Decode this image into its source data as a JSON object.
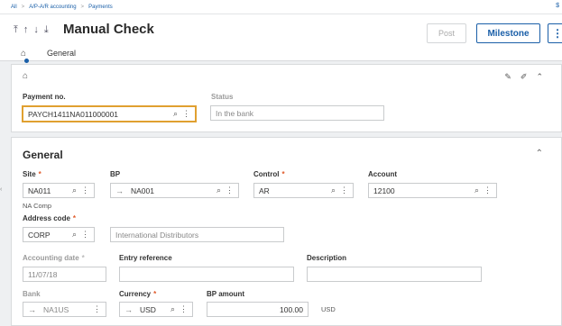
{
  "breadcrumb": {
    "items": [
      "All",
      "A/P-A/R accounting",
      "Payments"
    ]
  },
  "page": {
    "title": "Manual Check"
  },
  "nav": {
    "arrows": [
      "⤒",
      "↑",
      "↓",
      "⤓"
    ]
  },
  "actions": {
    "post_label": "Post",
    "milestone_label": "Milestone",
    "more_label": "⋮"
  },
  "tabs": {
    "general_label": "General"
  },
  "header_section": {
    "payment_no_label": "Payment no.",
    "payment_no_value": "PAYCH1411NA011000001",
    "status_label": "Status",
    "status_value": "In the bank"
  },
  "general_section": {
    "title": "General",
    "site_label": "Site",
    "site_value": "NA011",
    "site_description": "NA Comp",
    "bp_label": "BP",
    "bp_value": "NA001",
    "control_label": "Control",
    "control_value": "AR",
    "account_label": "Account",
    "account_value": "12100",
    "address_code_label": "Address code",
    "address_code_value": "CORP",
    "address_name": "International Distributors",
    "accounting_date_label": "Accounting date",
    "accounting_date_value": "11/07/18",
    "entry_reference_label": "Entry reference",
    "entry_reference_value": "",
    "description_label": "Description",
    "description_value": "",
    "bank_label": "Bank",
    "bank_value": "NA1US",
    "currency_label": "Currency",
    "currency_value": "USD",
    "bp_amount_label": "BP amount",
    "bp_amount_value": "100.00",
    "bp_amount_currency": "USD"
  },
  "required_marker": "*",
  "icons": {
    "home": "home-icon",
    "search": "search-icon",
    "more": "more-icon",
    "arrow": "arrow-right-icon",
    "pin": "pin-icon",
    "edit": "pencil-icon",
    "collapse": "chevron-up-icon"
  }
}
